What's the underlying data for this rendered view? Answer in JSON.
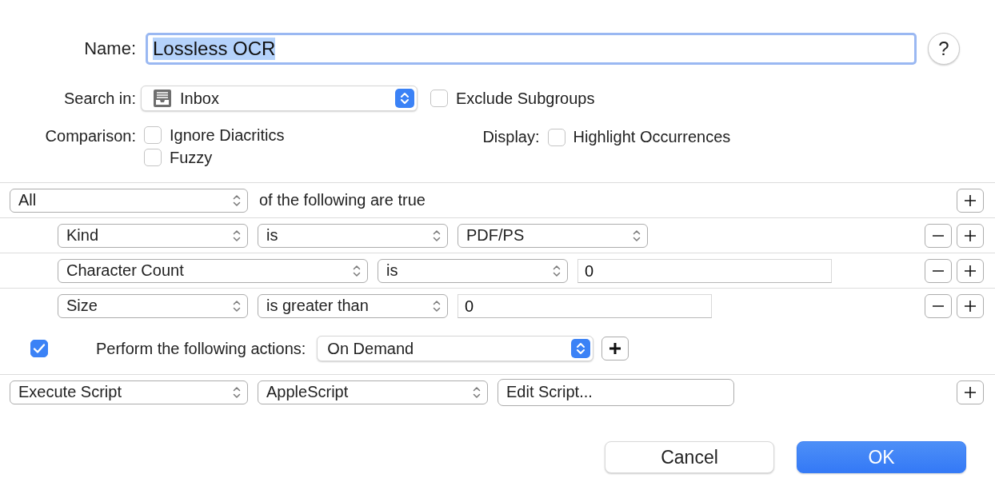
{
  "name_field": {
    "label": "Name:",
    "value": "Lossless OCR",
    "text_selected": true,
    "help": "?"
  },
  "search_in": {
    "label": "Search in:",
    "value": "Inbox",
    "kind": "push-popup"
  },
  "exclude_subgroups": {
    "label": "Exclude Subgroups",
    "checked": false
  },
  "comparison": {
    "label": "Comparison:",
    "options": [
      {
        "label": "Ignore Diacritics",
        "checked": false
      },
      {
        "label": "Fuzzy",
        "checked": false
      }
    ]
  },
  "display": {
    "label": "Display:",
    "options": [
      {
        "label": "Highlight Occurrences",
        "checked": false
      }
    ]
  },
  "conditions": {
    "match": "All",
    "suffix": "of the following are true",
    "rows": [
      {
        "fields": [
          {
            "kind": "popup",
            "value": "Kind"
          },
          {
            "kind": "popup",
            "value": "is"
          },
          {
            "kind": "popup",
            "value": "PDF/PS"
          }
        ]
      },
      {
        "fields": [
          {
            "kind": "popup",
            "value": "Character Count"
          },
          {
            "kind": "popup",
            "value": "is"
          },
          {
            "kind": "field",
            "value": "0"
          }
        ]
      },
      {
        "fields": [
          {
            "kind": "popup",
            "value": "Size"
          },
          {
            "kind": "popup",
            "value": "is greater than"
          },
          {
            "kind": "field",
            "value": "0"
          }
        ]
      }
    ]
  },
  "actions": {
    "enabled": true,
    "label": "Perform the following actions:",
    "trigger": {
      "kind": "push-popup",
      "value": "On Demand"
    },
    "rows": [
      {
        "fields": [
          {
            "kind": "popup",
            "value": "Execute Script"
          },
          {
            "kind": "popup",
            "value": "AppleScript"
          },
          {
            "kind": "button",
            "value": "Edit Script..."
          }
        ]
      }
    ]
  },
  "buttons": [
    {
      "label": "Cancel",
      "kind": "secondary"
    },
    {
      "label": "OK",
      "kind": "default"
    }
  ]
}
